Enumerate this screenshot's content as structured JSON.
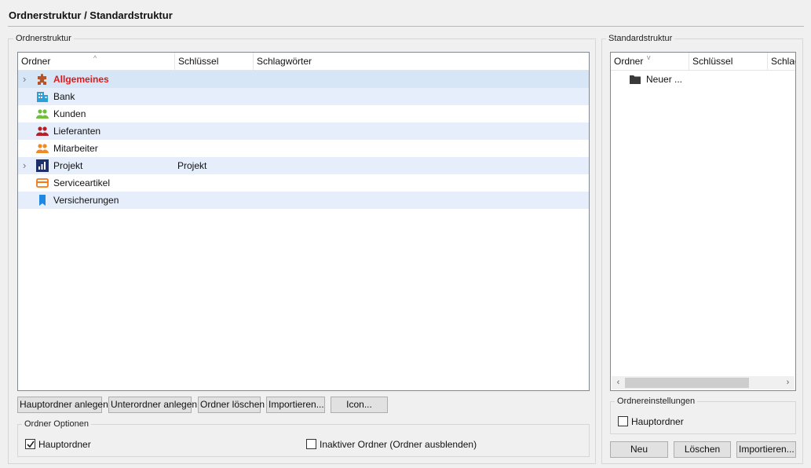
{
  "page": {
    "title": "Ordnerstruktur / Standardstruktur"
  },
  "left_panel": {
    "legend": "Ordnerstruktur",
    "columns": [
      "Ordner",
      "Schlüssel",
      "Schlagwörter"
    ],
    "rows": [
      {
        "label": "Allgemeines",
        "key": "",
        "icon": "puzzle-icon",
        "expandable": true,
        "bold": true
      },
      {
        "label": "Bank",
        "key": "",
        "icon": "building-icon",
        "expandable": false,
        "bold": false
      },
      {
        "label": "Kunden",
        "key": "",
        "icon": "people-green-icon",
        "expandable": false,
        "bold": false
      },
      {
        "label": "Lieferanten",
        "key": "",
        "icon": "people-red-icon",
        "expandable": false,
        "bold": false
      },
      {
        "label": "Mitarbeiter",
        "key": "",
        "icon": "people-orange-icon",
        "expandable": false,
        "bold": false
      },
      {
        "label": "Projekt",
        "key": "Projekt",
        "icon": "chart-icon",
        "expandable": true,
        "bold": false
      },
      {
        "label": "Serviceartikel",
        "key": "",
        "icon": "card-icon",
        "expandable": false,
        "bold": false
      },
      {
        "label": "Versicherungen",
        "key": "",
        "icon": "bookmark-icon",
        "expandable": false,
        "bold": false
      }
    ],
    "buttons": {
      "add_main": "Hauptordner anlegen",
      "add_sub": "Unterordner anlegen",
      "delete": "Ordner löschen",
      "import": "Importieren...",
      "icon": "Icon..."
    },
    "options": {
      "legend": "Ordner Optionen",
      "main_folder_label": "Hauptordner",
      "main_folder_checked": true,
      "inactive_label": "Inaktiver Ordner (Ordner ausblenden)",
      "inactive_checked": false
    }
  },
  "right_panel": {
    "legend": "Standardstruktur",
    "columns": [
      "Ordner",
      "Schlüssel",
      "Schlagwörter"
    ],
    "rows": [
      {
        "label": "Neuer ...",
        "icon": "folder-icon"
      }
    ],
    "settings": {
      "legend": "Ordnereinstellungen",
      "main_folder_label": "Hauptordner",
      "main_folder_checked": false
    },
    "buttons": {
      "new": "Neu",
      "delete": "Löschen",
      "import": "Importieren..."
    }
  },
  "colors": {
    "selected_row": "#d6e6f7",
    "alt_row": "#e6eefb",
    "highlight_text": "#e01818"
  }
}
